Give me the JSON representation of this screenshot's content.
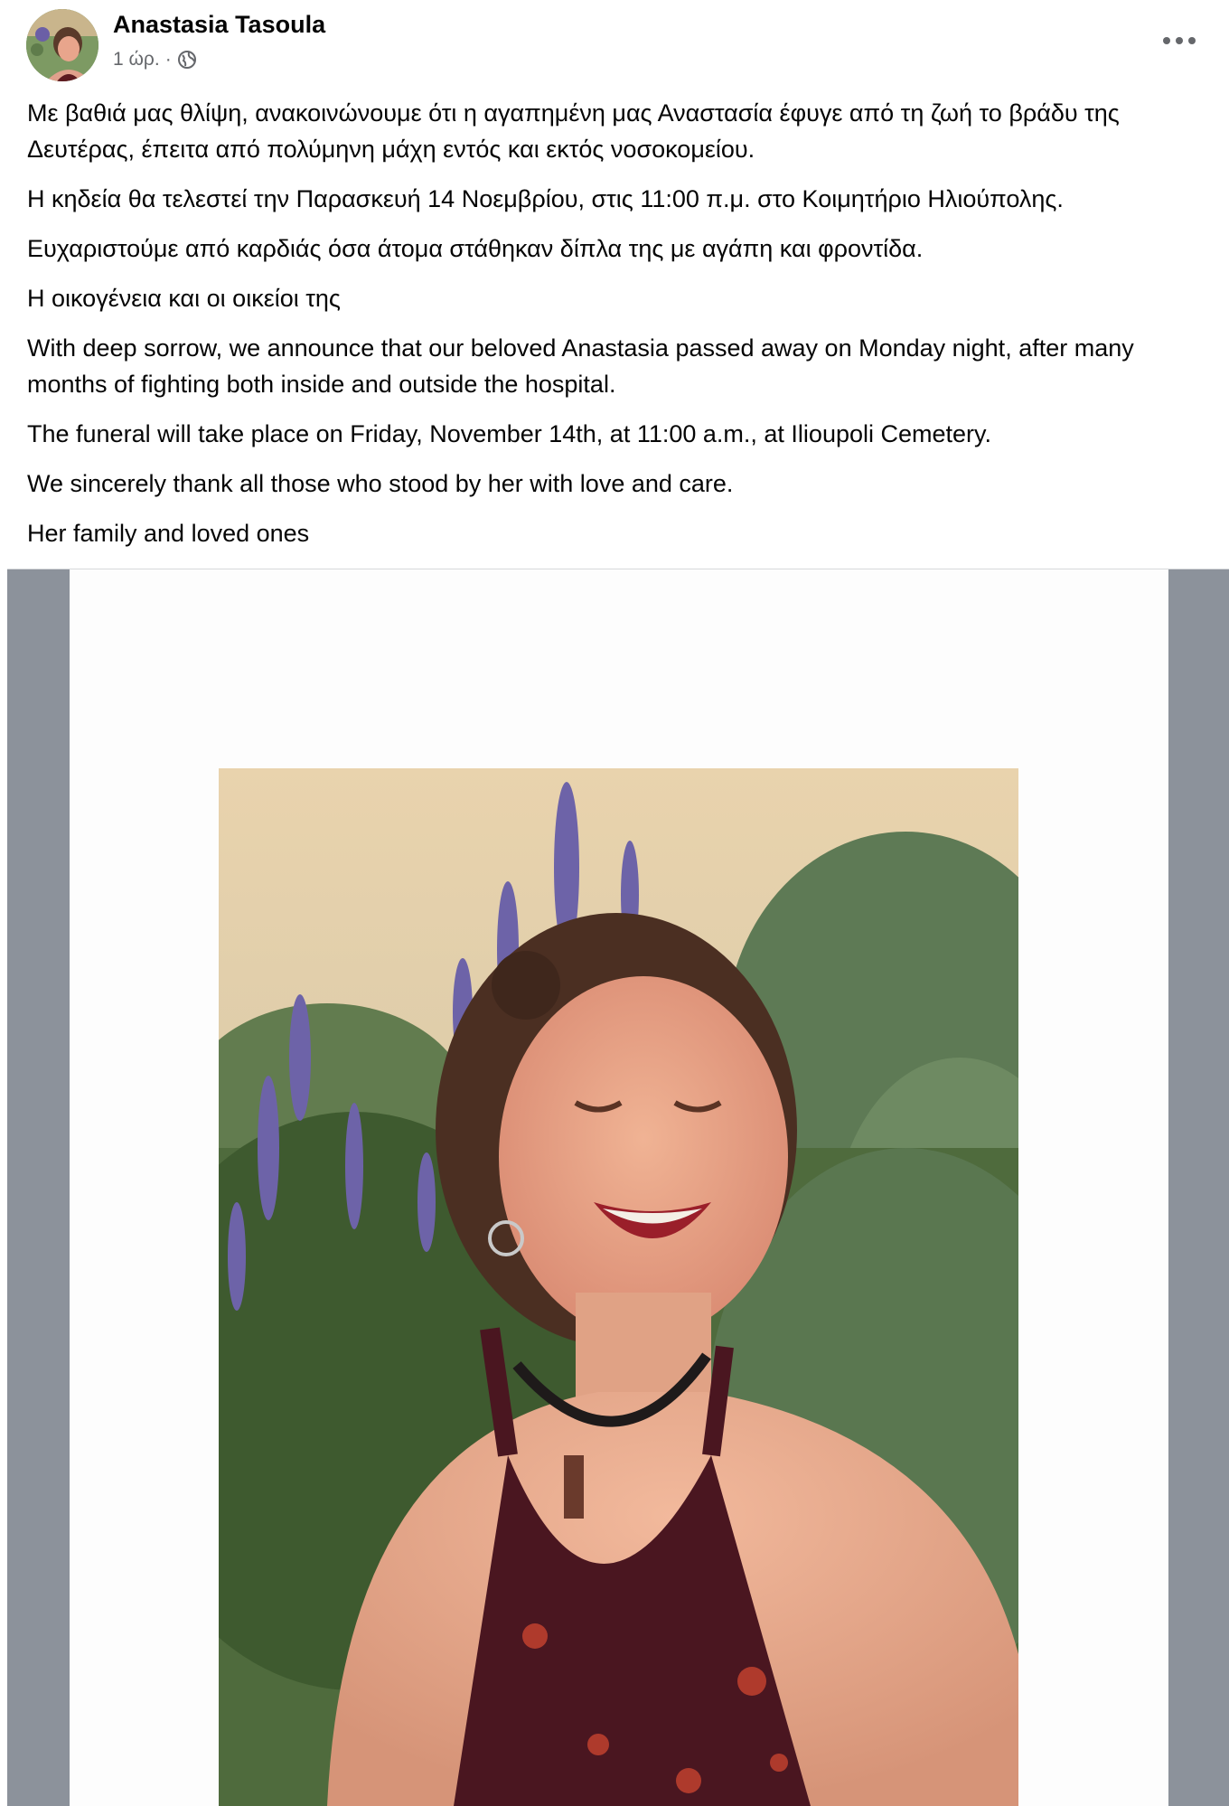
{
  "post": {
    "author": "Anastasia Tasoula",
    "time": "1 ώρ.",
    "separator": "·",
    "privacy_icon": "globe-icon",
    "more_icon": "more-options-icon",
    "paragraphs": [
      "Με βαθιά μας θλίψη, ανακοινώνουμε ότι η αγαπημένη μας Αναστασία έφυγε από τη ζωή το βράδυ της Δευτέρας, έπειτα από πολύμηνη μάχη εντός και εκτός νοσοκομείου.",
      "Η κηδεία θα τελεστεί την Παρασκευή 14 Νοεμβρίου, στις 11:00 π.μ. στο Κοιμητήριο Ηλιούπολης.",
      "Ευχαριστούμε από καρδιάς όσα άτομα στάθηκαν δίπλα της με αγάπη και φροντίδα.",
      "Η οικογένεια και οι οικείοι της",
      "With deep sorrow, we announce that our beloved Anastasia passed away on Monday night, after many months of fighting both inside and outside the hospital.",
      "The funeral will take place on Friday, November 14th, at 11:00 a.m., at Ilioupoli Cemetery.",
      "We sincerely thank all those who stood by her with love and care.",
      "Her family and loved ones"
    ]
  },
  "colors": {
    "media_background": "#8c929b",
    "card_background": "#fdfdfd",
    "secondary_text": "#65676b"
  }
}
